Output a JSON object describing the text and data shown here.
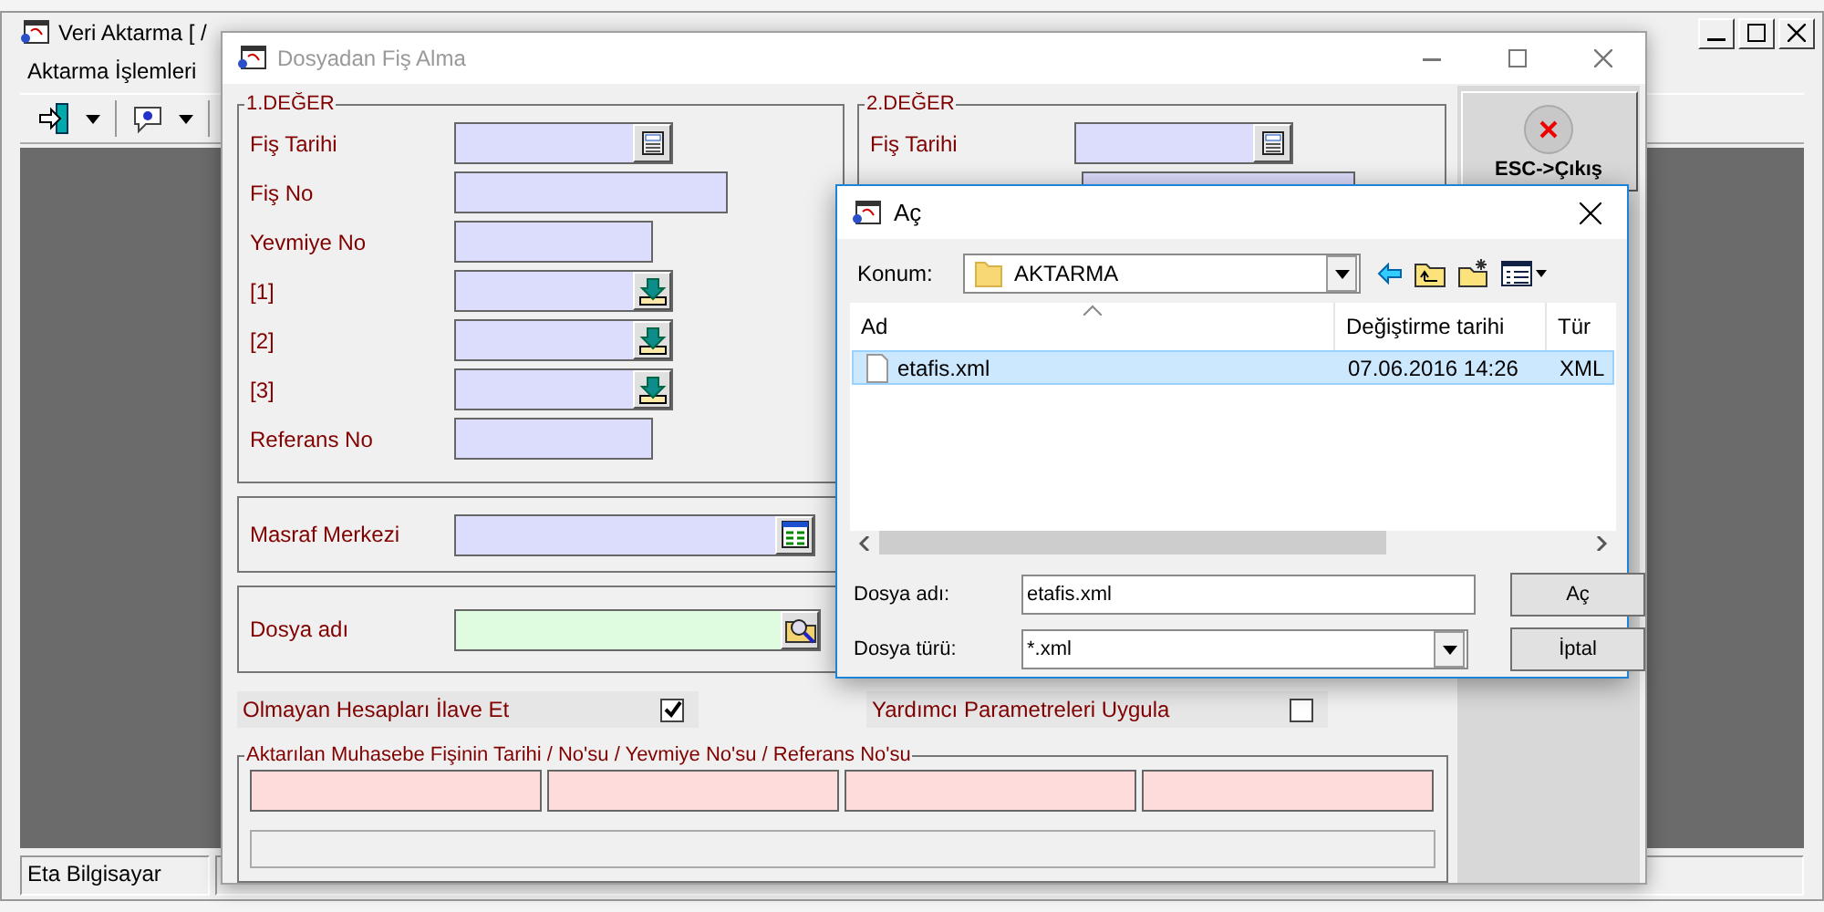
{
  "main_window": {
    "title": "Veri Aktarma [ /",
    "menu": [
      "Aktarma İşlemleri"
    ],
    "status_bar": [
      "Eta Bilgisayar"
    ]
  },
  "dialog": {
    "title": "Dosyadan Fiş Alma",
    "group_1": {
      "title": "1.DEĞER",
      "fields": [
        {
          "label": "Fiş Tarihi",
          "kind": "date"
        },
        {
          "label": "Fiş No",
          "kind": "text"
        },
        {
          "label": "Yevmiye No",
          "kind": "number"
        },
        {
          "label": "[1]",
          "kind": "lookup"
        },
        {
          "label": "[2]",
          "kind": "lookup"
        },
        {
          "label": "[3]",
          "kind": "lookup"
        },
        {
          "label": "Referans No",
          "kind": "number"
        }
      ]
    },
    "group_2": {
      "title": "2.DEĞER",
      "fields": [
        {
          "label": "Fiş Tarihi",
          "kind": "date"
        }
      ]
    },
    "cost_center": {
      "label": "Masraf Merkezi"
    },
    "file_name": {
      "label": "Dosya adı"
    },
    "options": [
      {
        "label": "Olmayan Hesapları İlave Et",
        "checked": true
      },
      {
        "label": "Yardımcı Parametreleri Uygula",
        "checked": false
      }
    ],
    "result_group": {
      "title": "Aktarılan Muhasebe Fişinin Tarihi / No'su / Yevmiye No'su / Referans No'su"
    },
    "exit_button": "ESC->Çıkış"
  },
  "open_dialog": {
    "title": "Aç",
    "location_label": "Konum:",
    "location": "AKTARMA",
    "columns": [
      {
        "label": "Ad",
        "sorted": true
      },
      {
        "label": "Değiştirme tarihi",
        "sorted": false
      },
      {
        "label": "Tür",
        "sorted": false
      }
    ],
    "rows": [
      {
        "name": "etafis.xml",
        "modified": "07.06.2016 14:26",
        "type": "XML",
        "selected": true
      }
    ],
    "file_name_label": "Dosya adı:",
    "file_name": "etafis.xml",
    "file_type_label": "Dosya türü:",
    "file_type": "*.xml",
    "buttons": [
      "Aç",
      "İptal"
    ]
  }
}
